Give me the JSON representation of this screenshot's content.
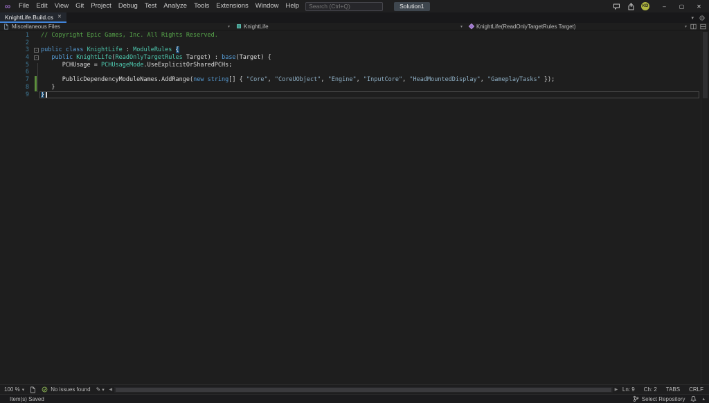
{
  "colors": {
    "accent": "#4083d9",
    "keyword": "#569cd6",
    "type": "#4ec9b0",
    "string": "#8fb0c6",
    "comment": "#57a64a",
    "line_number": "#3f7a99"
  },
  "title_bar": {
    "menu": [
      "File",
      "Edit",
      "View",
      "Git",
      "Project",
      "Debug",
      "Test",
      "Analyze",
      "Tools",
      "Extensions",
      "Window",
      "Help"
    ],
    "search": {
      "placeholder": "Search (Ctrl+Q)"
    },
    "solution_label": "Solution1",
    "avatar_initials": "KD",
    "window_buttons": {
      "minimize": "–",
      "maximize": "▢",
      "close": "✕"
    },
    "logo_glyph": "∞"
  },
  "tab_strip": {
    "active_tab": {
      "label": "KnightLife.Build.cs",
      "close_glyph": "✕"
    },
    "overflow_chevron": "▾"
  },
  "breadcrumb": {
    "chevron": "▾",
    "segments": [
      {
        "label": "Miscellaneous Files",
        "icon": "file"
      },
      {
        "label": "KnightLife",
        "icon": "class"
      },
      {
        "label": "KnightLife(ReadOnlyTargetRules Target)",
        "icon": "method"
      }
    ]
  },
  "editor": {
    "lines": [
      {
        "n": 1,
        "tokens": [
          {
            "c": "cm",
            "t": "// Copyright Epic Games, Inc. All Rights Reserved."
          }
        ]
      },
      {
        "n": 2,
        "tokens": []
      },
      {
        "n": 3,
        "fold": true,
        "tokens": [
          {
            "c": "kw",
            "t": "public"
          },
          {
            "c": "pl",
            "t": " "
          },
          {
            "c": "kw",
            "t": "class"
          },
          {
            "c": "pl",
            "t": " "
          },
          {
            "c": "ty",
            "t": "KnightLife"
          },
          {
            "c": "pl",
            "t": " : "
          },
          {
            "c": "ty",
            "t": "ModuleRules"
          },
          {
            "c": "pl",
            "t": " "
          },
          {
            "c": "br",
            "t": "{"
          }
        ]
      },
      {
        "n": 4,
        "fold": true,
        "tokens": [
          {
            "c": "pl",
            "t": "   "
          },
          {
            "c": "kw",
            "t": "public"
          },
          {
            "c": "pl",
            "t": " "
          },
          {
            "c": "ty",
            "t": "KnightLife"
          },
          {
            "c": "pl",
            "t": "("
          },
          {
            "c": "ty",
            "t": "ReadOnlyTargetRules"
          },
          {
            "c": "pl",
            "t": " "
          },
          {
            "c": "id",
            "t": "Target"
          },
          {
            "c": "pl",
            "t": ") : "
          },
          {
            "c": "kw",
            "t": "base"
          },
          {
            "c": "pl",
            "t": "("
          },
          {
            "c": "id",
            "t": "Target"
          },
          {
            "c": "pl",
            "t": ") {"
          }
        ]
      },
      {
        "n": 5,
        "tokens": [
          {
            "c": "pl",
            "t": "      "
          },
          {
            "c": "id",
            "t": "PCHUsage"
          },
          {
            "c": "pl",
            "t": " = "
          },
          {
            "c": "ty",
            "t": "PCHUsageMode"
          },
          {
            "c": "pl",
            "t": "."
          },
          {
            "c": "id",
            "t": "UseExplicitOrSharedPCHs"
          },
          {
            "c": "pl",
            "t": ";"
          }
        ]
      },
      {
        "n": 6,
        "tokens": []
      },
      {
        "n": 7,
        "change": true,
        "tokens": [
          {
            "c": "pl",
            "t": "      "
          },
          {
            "c": "id",
            "t": "PublicDependencyModuleNames"
          },
          {
            "c": "pl",
            "t": "."
          },
          {
            "c": "id",
            "t": "AddRange"
          },
          {
            "c": "pl",
            "t": "("
          },
          {
            "c": "kw",
            "t": "new"
          },
          {
            "c": "pl",
            "t": " "
          },
          {
            "c": "kw",
            "t": "string"
          },
          {
            "c": "pl",
            "t": "[] { "
          },
          {
            "c": "st",
            "t": "\"Core\""
          },
          {
            "c": "pl",
            "t": ", "
          },
          {
            "c": "st",
            "t": "\"CoreUObject\""
          },
          {
            "c": "pl",
            "t": ", "
          },
          {
            "c": "st",
            "t": "\"Engine\""
          },
          {
            "c": "pl",
            "t": ", "
          },
          {
            "c": "st",
            "t": "\"InputCore\""
          },
          {
            "c": "pl",
            "t": ", "
          },
          {
            "c": "st",
            "t": "\"HeadMountedDisplay\""
          },
          {
            "c": "pl",
            "t": ", "
          },
          {
            "c": "st",
            "t": "\"GameplayTasks\""
          },
          {
            "c": "pl",
            "t": " });"
          }
        ]
      },
      {
        "n": 8,
        "change": true,
        "tokens": [
          {
            "c": "pl",
            "t": "   }"
          }
        ]
      },
      {
        "n": 9,
        "current": true,
        "caret": true,
        "tokens": [
          {
            "c": "br",
            "t": "}"
          }
        ]
      }
    ]
  },
  "editor_status": {
    "zoom": "100 %",
    "zoom_chevron": "▾",
    "health": "No issues found",
    "pencil_glyph": "✎",
    "pencil_chevron": "▾",
    "scroll_left": "◀",
    "scroll_right": "▶",
    "line": "Ln: 9",
    "column": "Ch: 2",
    "tabs_mode": "TABS",
    "eol": "CRLF"
  },
  "status_bar": {
    "message": "Item(s) Saved",
    "repository": "Select Repository",
    "expand_glyph": "▴"
  }
}
